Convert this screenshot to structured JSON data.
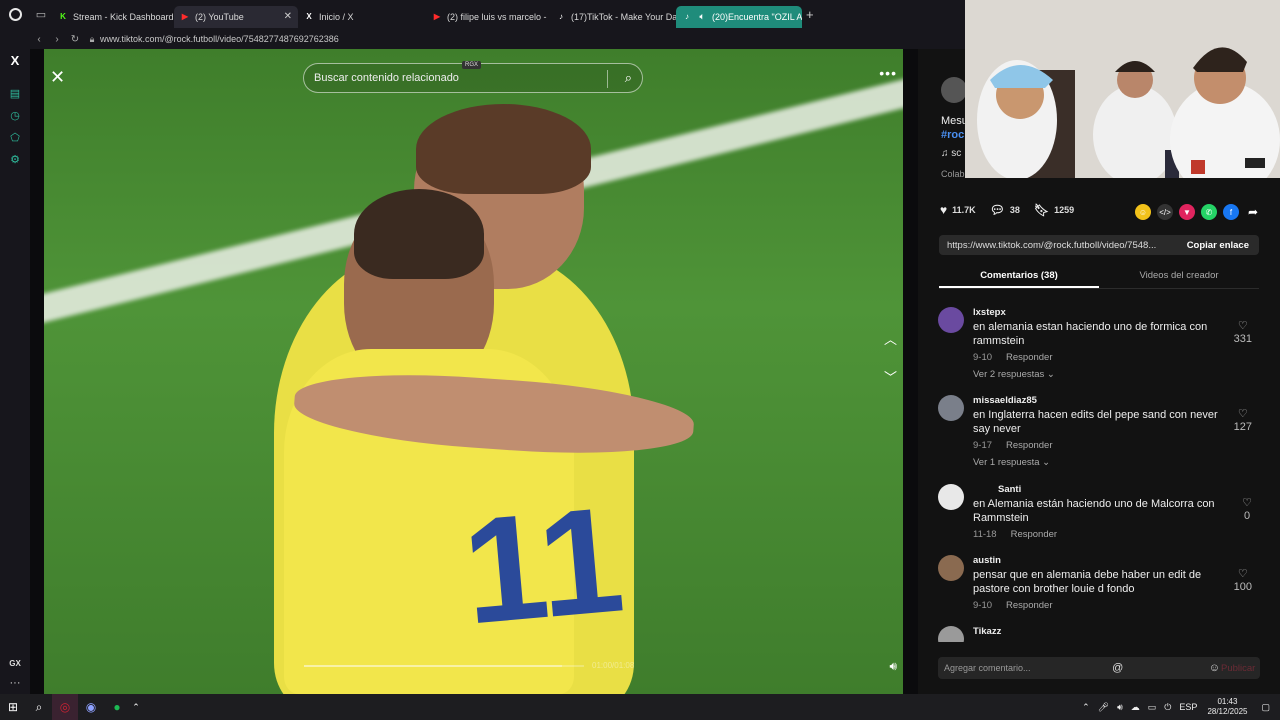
{
  "browser": {
    "tabs": [
      {
        "label": "Stream - Kick Dashboard",
        "favicon": "K",
        "color": "#53fc18"
      },
      {
        "label": "(2) YouTube",
        "favicon": "▶",
        "color": "#ff0000",
        "active": true
      },
      {
        "label": "Inicio / X",
        "favicon": "X",
        "color": "#ffffff"
      },
      {
        "label": "(2) filipe luis vs marcelo -",
        "favicon": "▶",
        "color": "#ff0000"
      },
      {
        "label": "(17)TikTok - Make Your Da",
        "favicon": "♪",
        "color": "#ffffff"
      },
      {
        "label": "(20)Encuentra \"OZIL A",
        "favicon": "♪",
        "color": "#ffffff",
        "audio": true
      }
    ],
    "url": "www.tiktok.com/@rock.futboll/video/7548277487692762386"
  },
  "video": {
    "search_placeholder": "Buscar contenido relacionado",
    "rgx_badge": "RGX",
    "time": "01:00/01:08",
    "progress": 0.92
  },
  "panel": {
    "desc_title": "Mesu",
    "desc_tag": "#roc",
    "desc_music": "♫ sc",
    "desc_colab": "Colab",
    "likes": "11.7K",
    "comments": "38",
    "saves": "1259",
    "link": "https://www.tiktok.com/@rock.futboll/video/7548...",
    "copy_label": "Copiar enlace",
    "tab_comments": "Comentarios (38)",
    "tab_creator": "Videos del creador",
    "add_comment_placeholder": "Agregar comentario...",
    "publish_label": "Publicar"
  },
  "comments": [
    {
      "user": "lxstepx",
      "text": "en alemania estan haciendo uno de formica con rammstein",
      "date": "9-10",
      "reply": "Responder",
      "replies": "Ver 2 respuestas ⌄",
      "likes": "331",
      "avatar": "#6a4aa0"
    },
    {
      "user": "missaeldiaz85",
      "text": "en Inglaterra hacen edits del pepe sand con never say never",
      "date": "9-17",
      "reply": "Responder",
      "replies": "Ver 1 respuesta ⌄",
      "likes": "127",
      "avatar": "#7a7f8a"
    },
    {
      "user": "Santi",
      "text": "en Alemania están haciendo uno de Malcorra con Rammstein",
      "date": "11-18",
      "reply": "Responder",
      "replies": "",
      "likes": "0",
      "avatar": "#e8e8e8"
    },
    {
      "user": "austin",
      "text": "pensar que en alemania debe haber un edit de pastore con brother louie d fondo",
      "date": "9-10",
      "reply": "Responder",
      "replies": "",
      "likes": "100",
      "avatar": "#8a6a50"
    },
    {
      "user": "Tikazz",
      "text": "",
      "date": "",
      "reply": "",
      "replies": "",
      "likes": "",
      "avatar": "#9a9a9a"
    }
  ],
  "taskbar": {
    "lang": "ESP",
    "time": "01:43",
    "date": "28/12/2025"
  }
}
